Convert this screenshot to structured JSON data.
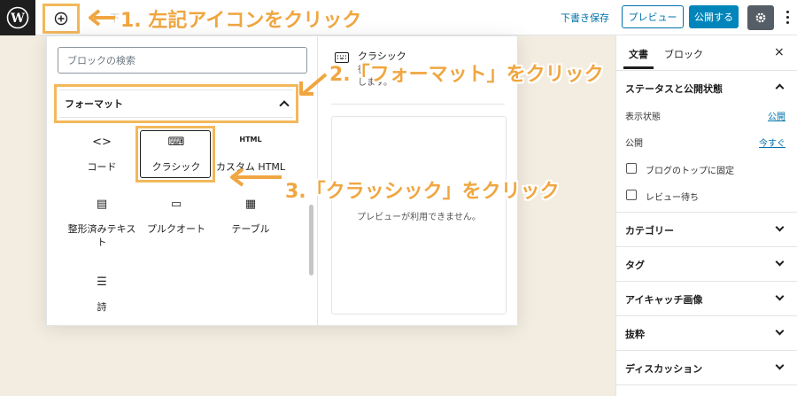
{
  "colors": {
    "accent": "#0085ba",
    "link": "#0073aa",
    "highlight": "#f3b85a",
    "annotation": "#f0a640",
    "background": "#f3ece0"
  },
  "topbar": {
    "faded_text": "下",
    "draft_label": "下書き保存",
    "preview_label": "プレビュー",
    "publish_label": "公開する"
  },
  "annotations": {
    "step1": "1. 左記アイコンをクリック",
    "step2": "2.「フォーマット」をクリック",
    "step3": "3.「クラッシック」をクリック"
  },
  "inserter": {
    "search_placeholder": "ブロックの検索",
    "category": "フォーマット",
    "blocks": [
      {
        "icon": "<>",
        "label": "コード"
      },
      {
        "icon": "⌨",
        "label": "クラシック"
      },
      {
        "icon": "HTML",
        "label": "カスタム HTML"
      },
      {
        "icon": "▤",
        "label": "整形済みテキスト"
      },
      {
        "icon": "▭",
        "label": "プルクオート"
      },
      {
        "icon": "▦",
        "label": "テーブル"
      },
      {
        "icon": "☰",
        "label": "詩"
      }
    ],
    "preview": {
      "title": "クラシック",
      "desc_top": "従",
      "desc_bottom": "します。",
      "empty": "プレビューが利用できません。"
    }
  },
  "sidebar": {
    "tab_document": "文書",
    "tab_block": "ブロック",
    "close": "×",
    "status": {
      "title": "ステータスと公開状態",
      "visibility_label": "表示状態",
      "visibility_value": "公開",
      "publish_label": "公開",
      "publish_value": "今すぐ",
      "sticky": "ブログのトップに固定",
      "pending": "レビュー待ち"
    },
    "panels": [
      "カテゴリー",
      "タグ",
      "アイキャッチ画像",
      "抜粋",
      "ディスカッション"
    ]
  }
}
